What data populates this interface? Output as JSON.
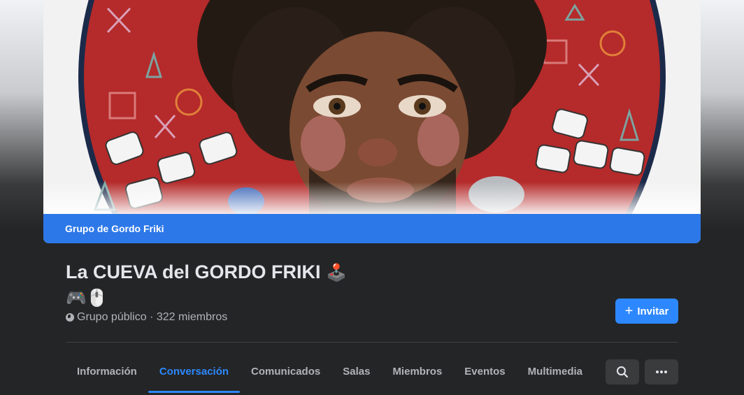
{
  "cover": {
    "group_label": "Grupo de Gordo Friki"
  },
  "group": {
    "title": "La CUEVA del GORDO FRIKI",
    "emoji_joystick": "🕹️",
    "emoji_line2": "🎮🖱️",
    "meta": "Grupo público · 322 miembros"
  },
  "actions": {
    "invite_label": "Invitar"
  },
  "tabs": [
    {
      "label": "Información"
    },
    {
      "label": "Conversación"
    },
    {
      "label": "Comunicados"
    },
    {
      "label": "Salas"
    },
    {
      "label": "Miembros"
    },
    {
      "label": "Eventos"
    },
    {
      "label": "Multimedia"
    }
  ],
  "active_tab": "Conversación",
  "icons": {
    "search": "search-icon",
    "more": "more-icon",
    "globe": "globe-icon",
    "plus": "plus-icon"
  },
  "colors": {
    "accent": "#2d88ff",
    "cover_strip": "#2d78e8",
    "background": "#242526"
  }
}
